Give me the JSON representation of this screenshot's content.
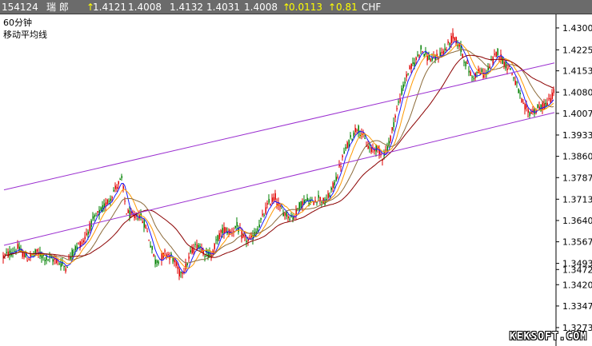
{
  "quote_bar": {
    "code": "154124",
    "name": "瑞    郎",
    "last_arrow": "↑",
    "last": "1.4121",
    "low": "1.4008",
    "high": "1.4132",
    "open": "1.4031",
    "prev": "1.4008",
    "change_arrow": "↑",
    "change": "0.0113",
    "pct_arrow": "↑",
    "pct": "0.81",
    "currency": "CHF"
  },
  "chart_labels": {
    "period": "60分钟",
    "indicator": "移动平均线"
  },
  "watermark": "KEKSOFT.COM",
  "colors": {
    "background": "#ffffff",
    "up_candle": "#008000",
    "down_candle": "#e00000",
    "channel": "#9b30d0",
    "ma_short": "#1a1aff",
    "ma_mid": "#ff9900",
    "ma_long1": "#8c6b3a",
    "ma_long2": "#8b0000"
  },
  "chart_data": {
    "type": "candlestick",
    "ylim": [
      1.324,
      1.433
    ],
    "y_ticks": [
      "1.4300",
      "1.4225",
      "1.4153",
      "1.4080",
      "1.4007",
      "1.3933",
      "1.3860",
      "1.3787",
      "1.3713",
      "1.3640",
      "1.3567",
      "1.3493",
      "1.3472",
      "1.3420",
      "1.3347",
      "1.3273"
    ],
    "price_path": [
      [
        0,
        1.351
      ],
      [
        10,
        1.3525
      ],
      [
        22,
        1.3545
      ],
      [
        34,
        1.351
      ],
      [
        46,
        1.353
      ],
      [
        58,
        1.351
      ],
      [
        70,
        1.3505
      ],
      [
        82,
        1.348
      ],
      [
        92,
        1.354
      ],
      [
        104,
        1.357
      ],
      [
        116,
        1.364
      ],
      [
        128,
        1.368
      ],
      [
        138,
        1.372
      ],
      [
        146,
        1.376
      ],
      [
        152,
        1.378
      ],
      [
        158,
        1.367
      ],
      [
        166,
        1.365
      ],
      [
        174,
        1.366
      ],
      [
        182,
        1.362
      ],
      [
        188,
        1.356
      ],
      [
        194,
        1.35
      ],
      [
        200,
        1.351
      ],
      [
        208,
        1.353
      ],
      [
        216,
        1.351
      ],
      [
        224,
        1.346
      ],
      [
        232,
        1.348
      ],
      [
        240,
        1.354
      ],
      [
        248,
        1.356
      ],
      [
        256,
        1.353
      ],
      [
        264,
        1.352
      ],
      [
        272,
        1.358
      ],
      [
        280,
        1.361
      ],
      [
        288,
        1.36
      ],
      [
        296,
        1.362
      ],
      [
        304,
        1.358
      ],
      [
        312,
        1.357
      ],
      [
        320,
        1.36
      ],
      [
        328,
        1.365
      ],
      [
        336,
        1.37
      ],
      [
        344,
        1.372
      ],
      [
        350,
        1.368
      ],
      [
        358,
        1.366
      ],
      [
        366,
        1.365
      ],
      [
        374,
        1.369
      ],
      [
        382,
        1.371
      ],
      [
        390,
        1.37
      ],
      [
        398,
        1.372
      ],
      [
        406,
        1.37
      ],
      [
        414,
        1.374
      ],
      [
        422,
        1.38
      ],
      [
        430,
        1.387
      ],
      [
        438,
        1.392
      ],
      [
        446,
        1.396
      ],
      [
        452,
        1.394
      ],
      [
        458,
        1.39
      ],
      [
        464,
        1.388
      ],
      [
        470,
        1.389
      ],
      [
        478,
        1.386
      ],
      [
        486,
        1.39
      ],
      [
        494,
        1.4
      ],
      [
        502,
        1.408
      ],
      [
        510,
        1.415
      ],
      [
        518,
        1.418
      ],
      [
        526,
        1.423
      ],
      [
        534,
        1.42
      ],
      [
        542,
        1.419
      ],
      [
        550,
        1.421
      ],
      [
        558,
        1.423
      ],
      [
        566,
        1.427
      ],
      [
        574,
        1.424
      ],
      [
        582,
        1.418
      ],
      [
        590,
        1.413
      ],
      [
        598,
        1.415
      ],
      [
        606,
        1.414
      ],
      [
        614,
        1.418
      ],
      [
        622,
        1.422
      ],
      [
        630,
        1.418
      ],
      [
        638,
        1.416
      ],
      [
        646,
        1.41
      ],
      [
        654,
        1.403
      ],
      [
        662,
        1.401
      ],
      [
        670,
        1.402
      ],
      [
        678,
        1.403
      ],
      [
        686,
        1.405
      ],
      [
        692,
        1.408
      ]
    ],
    "moving_averages": [
      {
        "color_key": "ma_short",
        "period": 5
      },
      {
        "color_key": "ma_mid",
        "period": 10
      },
      {
        "color_key": "ma_long1",
        "period": 20
      },
      {
        "color_key": "ma_long2",
        "period": 40
      }
    ],
    "channel_lines": [
      {
        "x1": 5,
        "y1": 1.3745,
        "x2": 693,
        "y2": 1.418
      },
      {
        "x1": 5,
        "y1": 1.3555,
        "x2": 693,
        "y2": 1.401
      }
    ]
  }
}
